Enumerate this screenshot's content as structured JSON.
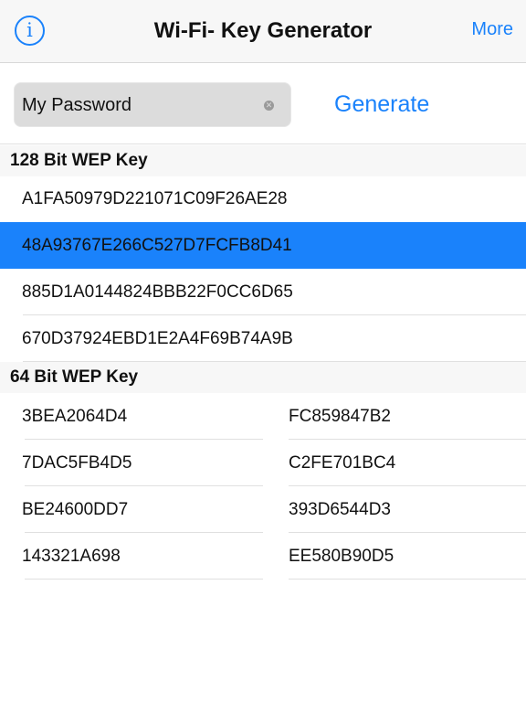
{
  "nav": {
    "title": "Wi-Fi- Key Generator",
    "more_label": "More",
    "info_icon": "info-icon"
  },
  "input": {
    "value": "My Password",
    "clear_icon": "clear-icon"
  },
  "generate_label": "Generate",
  "accent": "#1a82fb",
  "wep128": {
    "header": "128 Bit WEP Key",
    "keys": [
      "A1FA50979D221071C09F26AE28",
      "48A93767E266C527D7FCFB8D41",
      "885D1A0144824BBB22F0CC6D65",
      "670D37924EBD1E2A4F69B74A9B"
    ],
    "selected_index": 1
  },
  "wep64": {
    "header": "64 Bit WEP Key",
    "keys": [
      [
        "3BEA2064D4",
        "FC859847B2"
      ],
      [
        "7DAC5FB4D5",
        "C2FE701BC4"
      ],
      [
        "BE24600DD7",
        "393D6544D3"
      ],
      [
        "143321A698",
        "EE580B90D5"
      ]
    ]
  }
}
